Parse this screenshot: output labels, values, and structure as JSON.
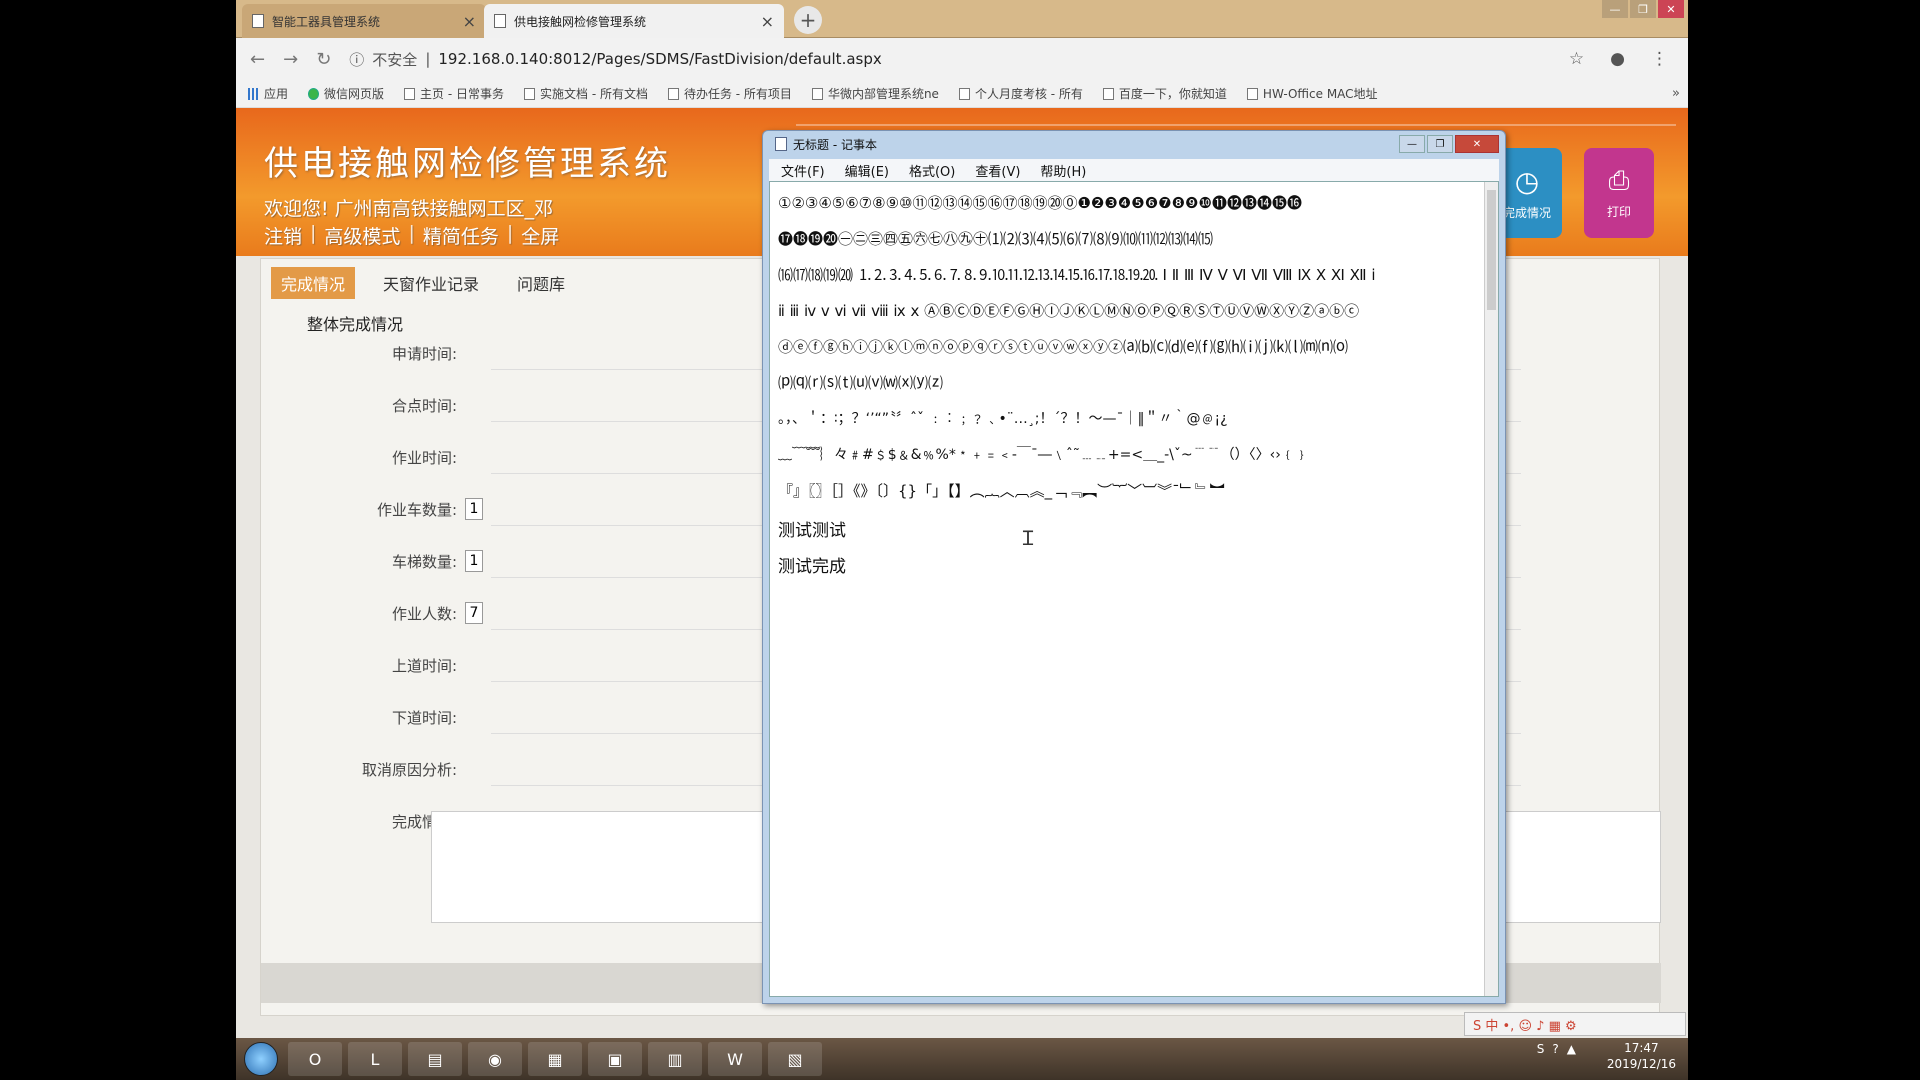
{
  "browser": {
    "tabs": [
      {
        "label": "智能工器具管理系统",
        "active": false
      },
      {
        "label": "供电接触网检修管理系统",
        "active": true
      }
    ],
    "url_security": "不安全",
    "url": "192.168.0.140:8012/Pages/SDMS/FastDivision/default.aspx",
    "bookmarks": [
      "应用",
      "微信网页版",
      "主页 - 日常事务",
      "实施文档 - 所有文档",
      "待办任务 - 所有项目",
      "华微内部管理系统ne",
      "个人月度考核 - 所有",
      "百度一下，你就知道",
      "HW-Office MAC地址"
    ],
    "bookmarks_more": "»"
  },
  "app": {
    "title": "供电接触网检修管理系统",
    "welcome": "欢迎您! 广州南高铁接触网工区_邓",
    "top_links": [
      "注销",
      "高级模式",
      "精简任务",
      "全屏"
    ],
    "top_icons": [
      {
        "label": "完成情况",
        "icon": "clock-icon"
      },
      {
        "label": "打印",
        "icon": "printer-icon"
      }
    ],
    "subtabs": [
      {
        "label": "完成情况",
        "active": true
      },
      {
        "label": "天窗作业记录",
        "active": false
      },
      {
        "label": "问题库",
        "active": false
      }
    ],
    "section_title": "整体完成情况",
    "fields": [
      {
        "label": "申请时间:",
        "value": ""
      },
      {
        "label": "合点时间:",
        "value": ""
      },
      {
        "label": "作业时间:",
        "value": ""
      },
      {
        "label": "作业车数量:",
        "value": "1"
      },
      {
        "label": "车梯数量:",
        "value": "1"
      },
      {
        "label": "作业人数:",
        "value": "7"
      },
      {
        "label": "上道时间:",
        "value": ""
      },
      {
        "label": "下道时间:",
        "value": ""
      },
      {
        "label": "取消原因分析:",
        "value": ""
      },
      {
        "label": "完成情况:",
        "value": ""
      }
    ]
  },
  "notepad": {
    "title": "无标题 - 记事本",
    "menu": [
      "文件(F)",
      "编辑(E)",
      "格式(O)",
      "查看(V)",
      "帮助(H)"
    ],
    "lines": [
      "①②③④⑤⑥⑦⑧⑨⑩⑪⑫⑬⑭⑮⑯⑰⑱⑲⑳⓪❶❷❸❹❺❻❼❽❾❿⓫⓬⓭⓮⓯⓰",
      "⓱⓲⓳⓴㊀㊁㊂㊃㊄㊅㊆㊇㊈㊉⑴⑵⑶⑷⑸⑹⑺⑻⑼⑽⑾⑿⒀⒁⒂",
      "⒃⒄⒅⒆⒇ ⒈⒉⒊⒋⒌⒍⒎⒏⒐⒑⒒⒓⒔⒕⒖⒗⒘⒙⒚⒛ Ⅰ Ⅱ Ⅲ Ⅳ Ⅴ Ⅵ Ⅶ Ⅷ Ⅸ Ⅹ Ⅺ Ⅻ ⅰ",
      "ⅱ ⅲ ⅳ ⅴ ⅵ ⅶ ⅷ ⅸ ⅹ ⒶⒷⒸⒹⒺⒻⒼⒽⒾⒿⓀⓁⓂⓃⓄⓅⓆⓇⓈⓉⓊⓋⓌⓍⓎⓏⓐⓑⓒ",
      "ⓓⓔⓕⓖⓗⓘⓙⓚⓛⓜⓝⓞⓟⓠⓡⓢⓣⓤⓥⓦⓧⓨⓩ⒜⒝⒞⒟⒠⒡⒢⒣⒤⒥⒦⒧⒨⒩⒪",
      "⒫⒬⒭⒮⒯⒰⒱⒲⒳⒴⒵",
      "。，、＇：∶；？‘’“”〝〞ˆˇ ﹕︰﹔﹖﹑•¨…¸;！´？！～—ˉ｜‖＂〃｀@﹫¡¿",
      "﹏﹋﹌︴々﹟#﹩$﹠&﹪%*﹡﹢﹦﹤‐￣¯―﹨ˆ˜﹍﹎+=<＿_-\\ˇ~﹉﹊（）〈〉‹›﹛﹜",
      "『』〖〗［］《》〔〕{}「」【】︵︷︿︹︽_﹁﹃︻︶︸﹀︺︾ˉ﹂﹄︼",
      "测试测试",
      "测试完成"
    ]
  },
  "taskbar": {
    "apps": [
      "O",
      "L",
      "▤",
      "◉",
      "▦",
      "▣",
      "▥",
      "W",
      "▧"
    ],
    "tray": [
      "S",
      "?",
      "▲"
    ],
    "time": "17:47",
    "date": "2019/12/16"
  },
  "ime": {
    "label": "S 中 •, ☺ ♪ ▦ ⚙"
  }
}
